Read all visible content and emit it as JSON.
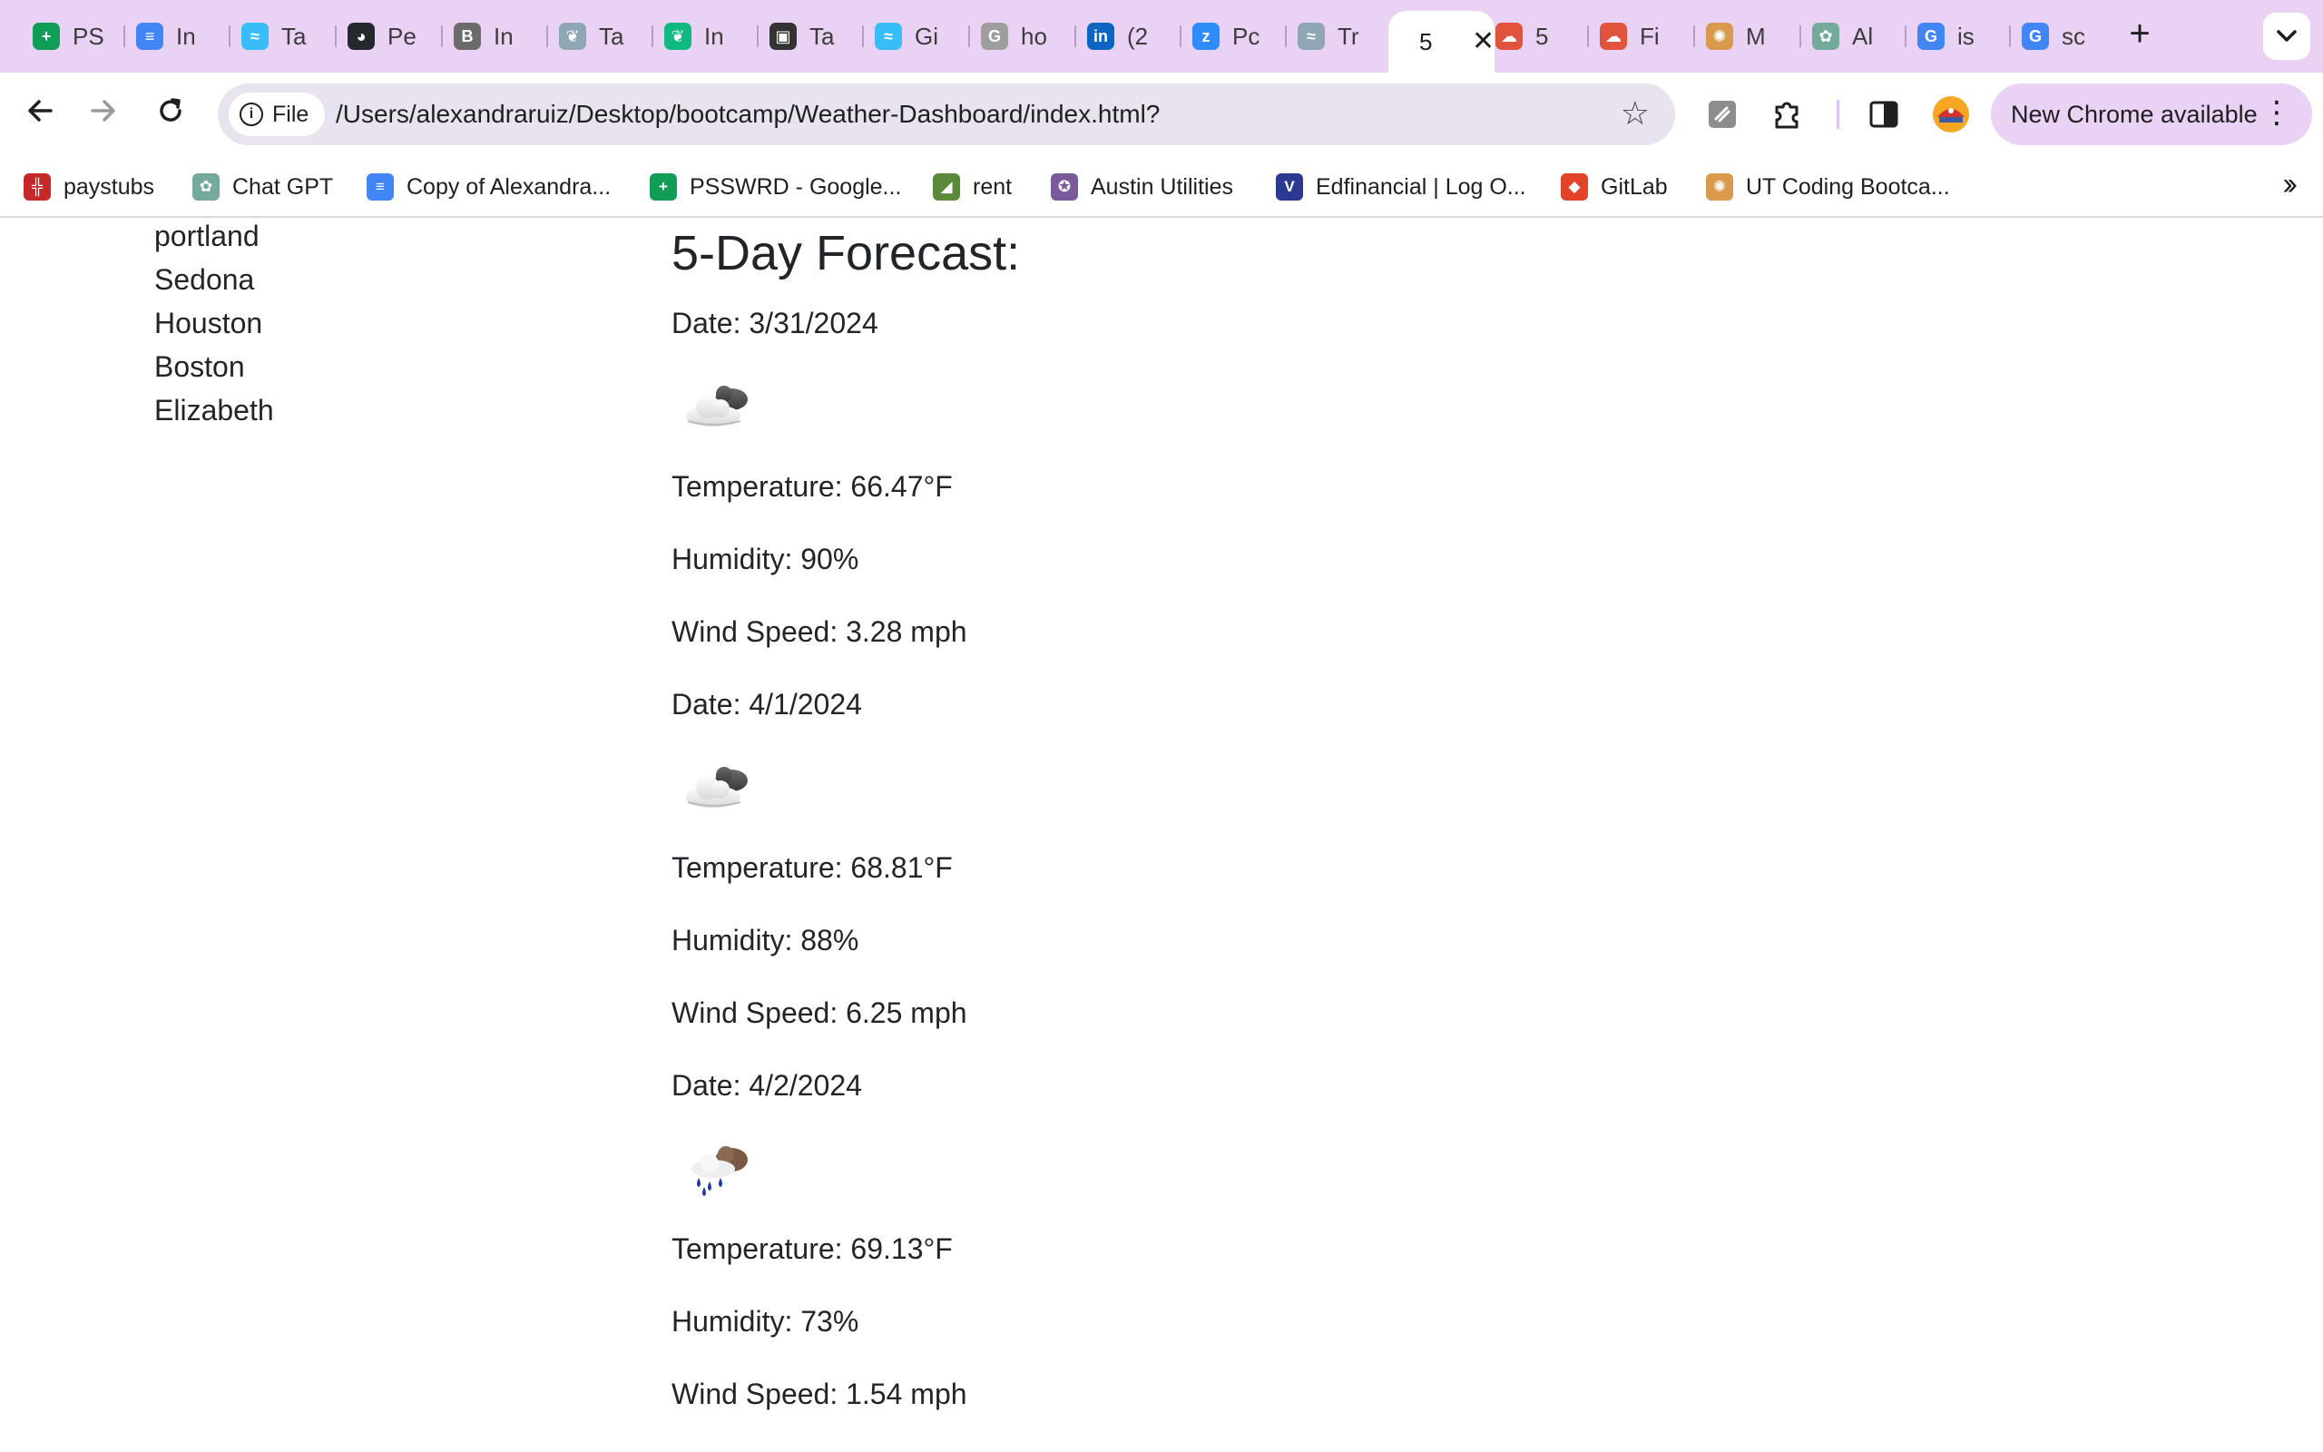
{
  "browser": {
    "tabs": [
      {
        "label": "PS",
        "icon": "sheets-icon",
        "color": "#0f9d58",
        "glyph": "+"
      },
      {
        "label": "In",
        "icon": "docs-icon",
        "color": "#4285f4",
        "glyph": "≡"
      },
      {
        "label": "Ta",
        "icon": "tailwind-icon",
        "color": "#38bdf8",
        "glyph": "≈"
      },
      {
        "label": "Pe",
        "icon": "github-icon",
        "color": "#24292f",
        "glyph": "◕"
      },
      {
        "label": "In",
        "icon": "bold-circle-icon",
        "color": "#6b6b6b",
        "glyph": "B"
      },
      {
        "label": "Ta",
        "icon": "leaf-circle-icon",
        "color": "#8fa6b5",
        "glyph": "❦"
      },
      {
        "label": "In",
        "icon": "leaf-icon",
        "color": "#10b981",
        "glyph": "❦"
      },
      {
        "label": "Ta",
        "icon": "app-square-icon",
        "color": "#333333",
        "glyph": "▣"
      },
      {
        "label": "Gi",
        "icon": "tailwind-icon",
        "color": "#38bdf8",
        "glyph": "≈"
      },
      {
        "label": "ho",
        "icon": "google-gray-icon",
        "color": "#9e9e9e",
        "glyph": "G"
      },
      {
        "label": "(2",
        "icon": "linkedin-icon",
        "color": "#0a66c2",
        "glyph": "in"
      },
      {
        "label": "Pc",
        "icon": "zoom-icon",
        "color": "#2d8cff",
        "glyph": "z"
      },
      {
        "label": "Tr",
        "icon": "circle-tool-icon",
        "color": "#8fa6b5",
        "glyph": "≈"
      },
      {
        "label": "5",
        "icon": "none",
        "color": "#ffffff",
        "glyph": "",
        "active": true
      },
      {
        "label": "5",
        "icon": "weather-red-icon",
        "color": "#e2533d",
        "glyph": "☁"
      },
      {
        "label": "Fi",
        "icon": "weather-red-icon",
        "color": "#e2533d",
        "glyph": "☁"
      },
      {
        "label": "M",
        "icon": "ut-seal-icon",
        "color": "#d99a4e",
        "glyph": "✺"
      },
      {
        "label": "Al",
        "icon": "chatgpt-icon",
        "color": "#74aa9c",
        "glyph": "✿"
      },
      {
        "label": "is",
        "icon": "google-icon",
        "color": "#4285f4",
        "glyph": "G"
      },
      {
        "label": "sc",
        "icon": "google-icon",
        "color": "#4285f4",
        "glyph": "G"
      }
    ],
    "new_tab_label": "+",
    "chip_label": "File",
    "url": "/Users/alexandraruiz/Desktop/bootcamp/Weather-Dashboard/index.html?",
    "update_label": "New Chrome available",
    "bookmarks": [
      {
        "label": "paystubs",
        "icon": "paystubs-icon",
        "color": "#c62828",
        "glyph": "╬"
      },
      {
        "label": "Chat GPT",
        "icon": "chatgpt-icon",
        "color": "#74aa9c",
        "glyph": "✿"
      },
      {
        "label": "Copy of Alexandra...",
        "icon": "docs-icon",
        "color": "#4285f4",
        "glyph": "≡"
      },
      {
        "label": "PSSWRD - Google...",
        "icon": "sheets-icon",
        "color": "#0f9d58",
        "glyph": "+"
      },
      {
        "label": "rent",
        "icon": "rent-icon",
        "color": "#5a8a3a",
        "glyph": "◢"
      },
      {
        "label": "Austin Utilities",
        "icon": "austin-seal-icon",
        "color": "#7a5a9a",
        "glyph": "✪"
      },
      {
        "label": "Edfinancial | Log O...",
        "icon": "edfinancial-icon",
        "color": "#2b3990",
        "glyph": "V"
      },
      {
        "label": "GitLab",
        "icon": "gitlab-icon",
        "color": "#e24329",
        "glyph": "◆"
      },
      {
        "label": "UT Coding Bootca...",
        "icon": "ut-seal-icon",
        "color": "#d99a4e",
        "glyph": "✺"
      }
    ]
  },
  "history": {
    "cities": [
      "portland",
      "Sedona",
      "Houston",
      "Boston",
      "Elizabeth"
    ]
  },
  "forecast": {
    "title": "5-Day Forecast:",
    "days": [
      {
        "date": "Date: 3/31/2024",
        "icon": "broken-clouds-icon",
        "temperature": "Temperature: 66.47°F",
        "humidity": "Humidity: 90%",
        "wind": "Wind Speed: 3.28 mph"
      },
      {
        "date": "Date: 4/1/2024",
        "icon": "broken-clouds-icon",
        "temperature": "Temperature: 68.81°F",
        "humidity": "Humidity: 88%",
        "wind": "Wind Speed: 6.25 mph"
      },
      {
        "date": "Date: 4/2/2024",
        "icon": "rain-icon",
        "temperature": "Temperature: 69.13°F",
        "humidity": "Humidity: 73%",
        "wind": "Wind Speed: 1.54 mph"
      }
    ]
  }
}
